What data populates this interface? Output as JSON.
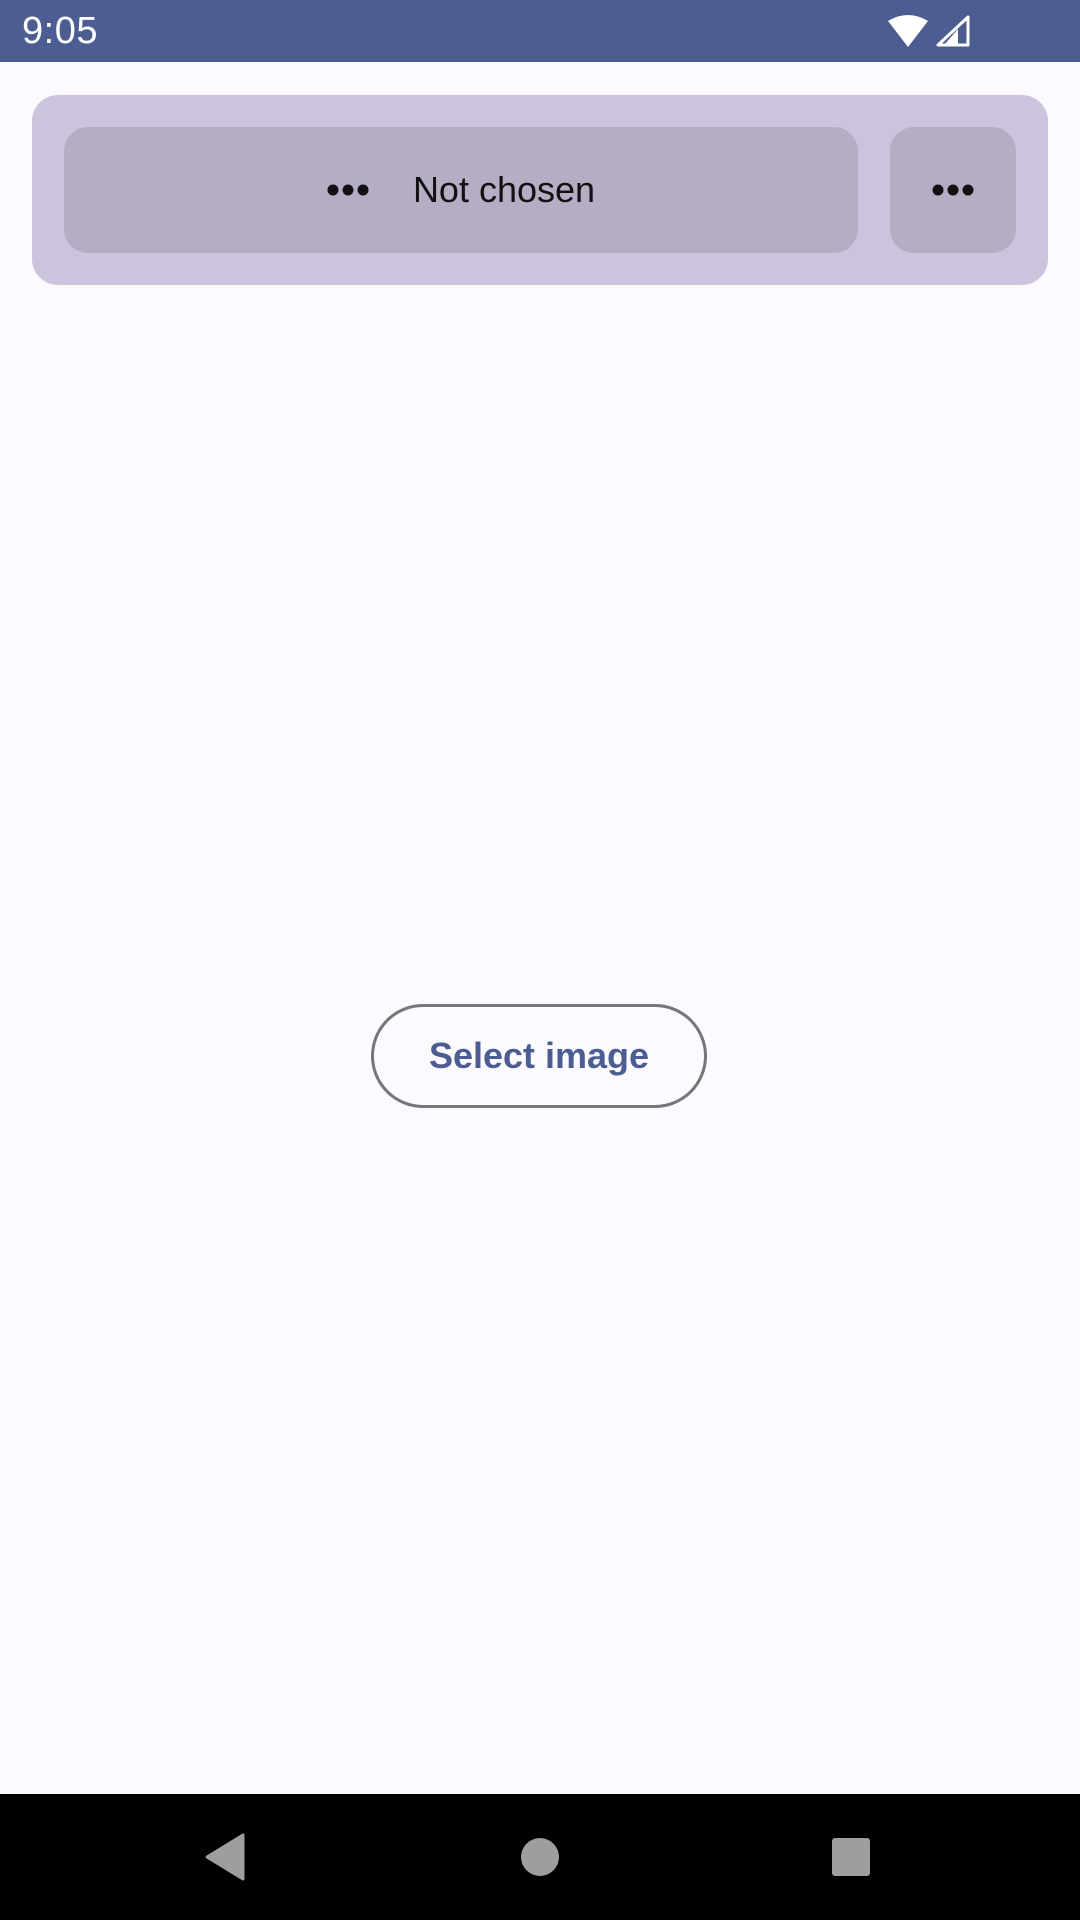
{
  "status_bar": {
    "time": "9:05",
    "icons": [
      "wifi-icon",
      "cellular-signal-icon"
    ],
    "background": "#4b5d91"
  },
  "top_card": {
    "chooser_label": "Not chosen",
    "chooser_icon": "more-horiz-icon",
    "more_icon": "more-horiz-icon",
    "background": "#cdc3dd",
    "button_background": "#b6adc5"
  },
  "main": {
    "select_image_label": "Select image",
    "accent": "#4b5d91"
  },
  "nav_bar": {
    "buttons": [
      "back-icon",
      "home-icon",
      "recents-icon"
    ]
  }
}
